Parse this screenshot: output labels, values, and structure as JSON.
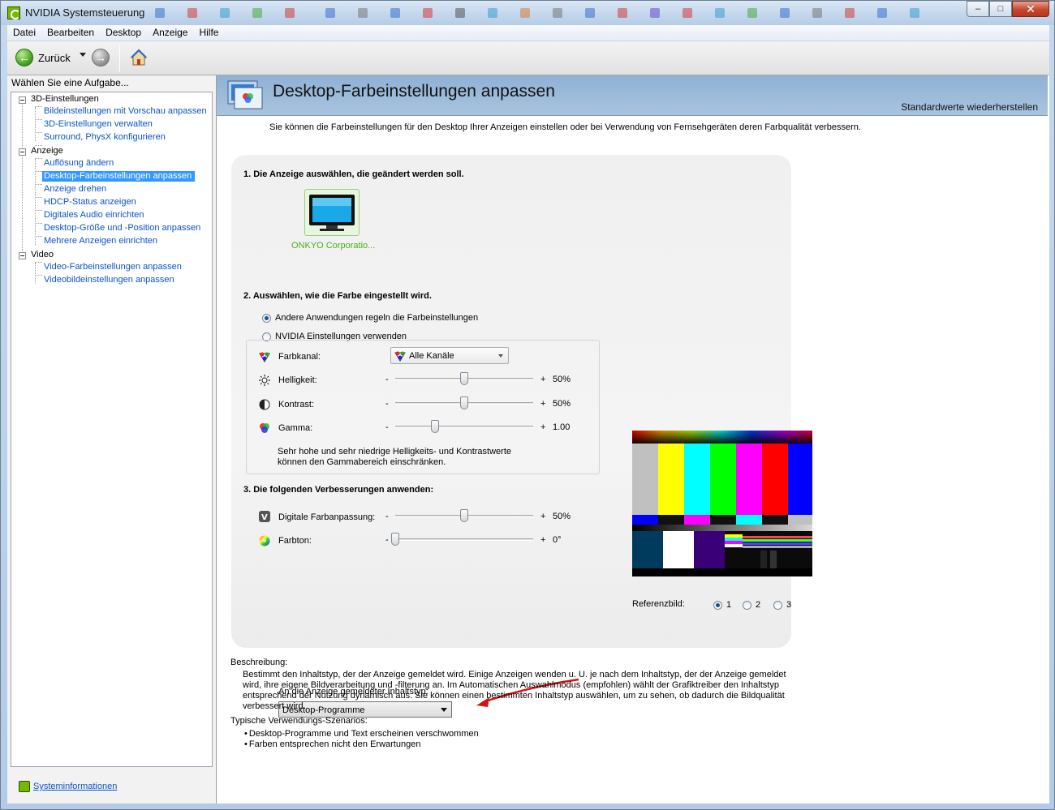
{
  "window": {
    "title": "NVIDIA Systemsteuerung"
  },
  "menu": [
    "Datei",
    "Bearbeiten",
    "Desktop",
    "Anzeige",
    "Hilfe"
  ],
  "toolbar": {
    "back_label": "Zurück"
  },
  "sidebar": {
    "task_title": "Wählen Sie eine Aufgabe...",
    "groups": [
      {
        "label": "3D-Einstellungen",
        "items": [
          "Bildeinstellungen mit Vorschau anpassen",
          "3D-Einstellungen verwalten",
          "Surround, PhysX konfigurieren"
        ]
      },
      {
        "label": "Anzeige",
        "items": [
          "Auflösung ändern",
          "Desktop-Farbeinstellungen anpassen",
          "Anzeige drehen",
          "HDCP-Status anzeigen",
          "Digitales Audio einrichten",
          "Desktop-Größe und -Position anpassen",
          "Mehrere Anzeigen einrichten"
        ]
      },
      {
        "label": "Video",
        "items": [
          "Video-Farbeinstellungen anpassen",
          "Videobildeinstellungen anpassen"
        ]
      }
    ],
    "selected_item": "Desktop-Farbeinstellungen anpassen",
    "sysinfo_link": "Systeminformationen"
  },
  "page": {
    "title": "Desktop-Farbeinstellungen anpassen",
    "restore": "Standardwerte wiederherstellen",
    "intro": "Sie können die Farbeinstellungen für den Desktop Ihrer Anzeigen einstellen oder bei Verwendung von Fernsehgeräten deren Farbqualität verbessern."
  },
  "step1": {
    "heading": "1. Die Anzeige auswählen, die geändert werden soll.",
    "display_name": "ONKYO Corporatio..."
  },
  "step2": {
    "heading": "2. Auswählen, wie die Farbe eingestellt wird.",
    "option_other": "Andere Anwendungen regeln die Farbeinstellungen",
    "option_nvidia": "NVIDIA Einstellungen verwenden",
    "selected_option": "other",
    "channel_label": "Farbkanal:",
    "channel_value": "Alle Kanäle",
    "brightness": {
      "label": "Helligkeit:",
      "minus": "-",
      "plus": "+",
      "value": "50%",
      "level": 0.5
    },
    "contrast": {
      "label": "Kontrast:",
      "minus": "-",
      "plus": "+",
      "value": "50%",
      "level": 0.5
    },
    "gamma": {
      "label": "Gamma:",
      "minus": "-",
      "plus": "+",
      "value": "1.00",
      "level": 0.29
    },
    "note": "Sehr hohe und sehr niedrige Helligkeits- und Kontrastwerte können den Gammabereich einschränken."
  },
  "step3": {
    "heading": "3. Die folgenden Verbesserungen anwenden:",
    "vibrance": {
      "label": "Digitale Farbanpassung:",
      "minus": "-",
      "plus": "+",
      "value": "50%",
      "level": 0.5
    },
    "hue": {
      "label": "Farbton:",
      "minus": "-",
      "plus": "+",
      "value": "0°",
      "level": 0.0
    },
    "content_type_label": "An die Anzeige gemeldeter Inhaltstyp:",
    "content_type_value": "Desktop-Programme"
  },
  "reference": {
    "label": "Referenzbild:",
    "options": [
      "1",
      "2",
      "3"
    ],
    "selected": "1"
  },
  "description": {
    "title": "Beschreibung:",
    "body": "Bestimmt den Inhaltstyp, der der Anzeige gemeldet wird. Einige Anzeigen wenden u. U. je nach dem Inhaltstyp, der der Anzeige gemeldet wird, ihre eigene Bildverarbeitung und -filterung an. Im Automatischen Auswahlmodus (empfohlen) wählt der Grafiktreiber den Inhaltstyp entsprechend der Nutzung dynamisch aus. Sie können einen bestimmten Inhaltstyp auswählen, um zu sehen, ob dadurch die Bildqualität verbessert wird.",
    "usage_title": "Typische Verwendungs-Szenarios:",
    "usage_items": [
      "Desktop-Programme und Text erscheinen verschwommen",
      "Farben entsprechen nicht den Erwartungen"
    ]
  },
  "colors": {
    "accent_link": "#0b53c7",
    "selection": "#3399ff",
    "nvidia_green": "#76b900",
    "arrow_red": "#d41414"
  }
}
